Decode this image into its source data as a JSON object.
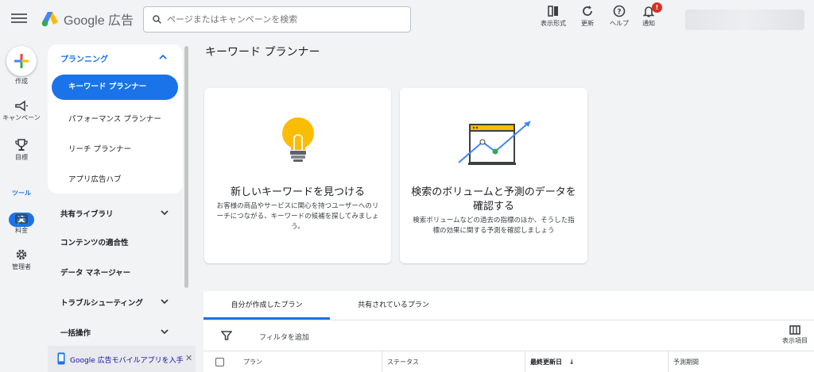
{
  "header": {
    "product_name": "Google 広告",
    "search_placeholder": "ページまたはキャンペーンを検索",
    "buttons": [
      {
        "label": "表示形式",
        "icon": "view-mode-icon"
      },
      {
        "label": "更新",
        "icon": "refresh-icon"
      },
      {
        "label": "ヘルプ",
        "icon": "help-icon"
      },
      {
        "label": "通知",
        "icon": "bell-icon"
      }
    ],
    "notification_badge": "!"
  },
  "rail": {
    "create_label": "作成",
    "items": [
      {
        "label": "キャンペーン",
        "icon": "megaphone-icon"
      },
      {
        "label": "目標",
        "icon": "trophy-icon"
      },
      {
        "label": "ツール",
        "icon": "tools-icon"
      },
      {
        "label": "料金",
        "icon": "credit-card-icon"
      },
      {
        "label": "管理者",
        "icon": "gear-icon"
      }
    ]
  },
  "sidebar": {
    "planning_heading": "プランニング",
    "planning_items": [
      "キーワード プランナー",
      "パフォーマンス プランナー",
      "リーチ プランナー",
      "アプリ広告ハブ"
    ],
    "sections": [
      {
        "label": "共有ライブラリ",
        "expandable": true
      },
      {
        "label": "コンテンツの適合性",
        "expandable": false
      },
      {
        "label": "データ マネージャー",
        "expandable": false
      },
      {
        "label": "トラブルシューティング",
        "expandable": true
      },
      {
        "label": "一括操作",
        "expandable": true
      }
    ],
    "mobile_app_link": "Google 広告モバイルアプリを入手",
    "mobile_app_close": "✕"
  },
  "main": {
    "title": "キーワード プランナー",
    "cards": [
      {
        "title": "新しいキーワードを見つける",
        "description": "お客様の商品やサービスに関心を持つユーザーへのリーチにつながる、キーワードの候補を探してみましょう。",
        "icon": "lightbulb-icon"
      },
      {
        "title": "検索のボリュームと予測のデータを確認する",
        "description": "検索ボリュームなどの過去の指標のほか、そうした指標の効果に関する予測を確認しましょう",
        "icon": "trend-chart-icon"
      }
    ],
    "tabs": [
      "自分が作成したプラン",
      "共有されているプラン"
    ],
    "active_tab": "自分が作成したプラン",
    "filter_label": "フィルタを追加",
    "columns_label": "表示項目",
    "table_columns": [
      "プラン",
      "ステータス",
      "最終更新日",
      "予測期間"
    ],
    "sort_indicator": "↓"
  },
  "colors": {
    "accent": "#1a73e8",
    "background": "#f1f3f4",
    "badge": "#d93025",
    "bulb": "#fbbc04"
  }
}
